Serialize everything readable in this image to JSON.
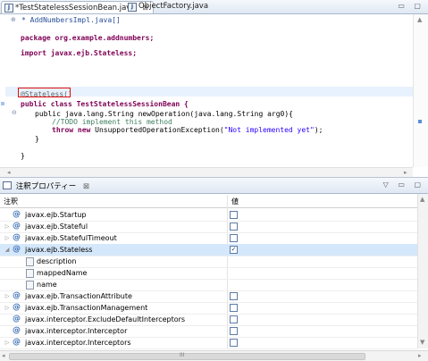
{
  "editor": {
    "tabs": [
      {
        "label": "*TestStatelessSessionBean.java",
        "close": "⊠",
        "active": true
      },
      {
        "label": "ObjectFactory.java",
        "close": "",
        "active": false
      }
    ],
    "window_buttons": "▭ ▢",
    "lines": {
      "import_summary": "* AddNumbersImpl.java[]",
      "package": "package org.example.addnumbers;",
      "import": "import javax.ejb.Stateless;",
      "annotation": "@Stateless()",
      "class_decl": "public class TestStatelessSessionBean {",
      "method_decl": "public java.lang.String newOperation(java.lang.String arg0){",
      "todo": "//TODO implement this method",
      "throw_kw": "throw new",
      "throw_cls": " UnsupportedOperationException(",
      "throw_str": "\"Not implemented yet\"",
      "throw_end": ");",
      "close_method": "}",
      "close_class": "}"
    }
  },
  "properties_view": {
    "title": "注釈プロパティー",
    "close": "⊠",
    "controls": "▽ ▭ ▢",
    "columns": {
      "name": "注釈",
      "value": "値"
    },
    "rows": [
      {
        "label": "javax.ejb.Startup",
        "type": "annotation",
        "expander": "",
        "checked": false
      },
      {
        "label": "javax.ejb.Stateful",
        "type": "annotation",
        "expander": "▷",
        "checked": false
      },
      {
        "label": "javax.ejb.StatefulTimeout",
        "type": "annotation",
        "expander": "▷",
        "checked": false
      },
      {
        "label": "javax.ejb.Stateless",
        "type": "annotation",
        "expander": "◢",
        "checked": true,
        "selected": true
      },
      {
        "label": "description",
        "type": "attribute",
        "expander": "",
        "checked": null
      },
      {
        "label": "mappedName",
        "type": "attribute",
        "expander": "",
        "checked": null
      },
      {
        "label": "name",
        "type": "attribute",
        "expander": "",
        "checked": null
      },
      {
        "label": "javax.ejb.TransactionAttribute",
        "type": "annotation",
        "expander": "▷",
        "checked": false
      },
      {
        "label": "javax.ejb.TransactionManagement",
        "type": "annotation",
        "expander": "▷",
        "checked": false
      },
      {
        "label": "javax.interceptor.ExcludeDefaultInterceptors",
        "type": "annotation",
        "expander": "",
        "checked": false
      },
      {
        "label": "javax.interceptor.Interceptor",
        "type": "annotation",
        "expander": "",
        "checked": false
      },
      {
        "label": "javax.interceptor.Interceptors",
        "type": "annotation",
        "expander": "▷",
        "checked": false
      }
    ],
    "checkmark": "✓",
    "scroll_grip": "III"
  }
}
